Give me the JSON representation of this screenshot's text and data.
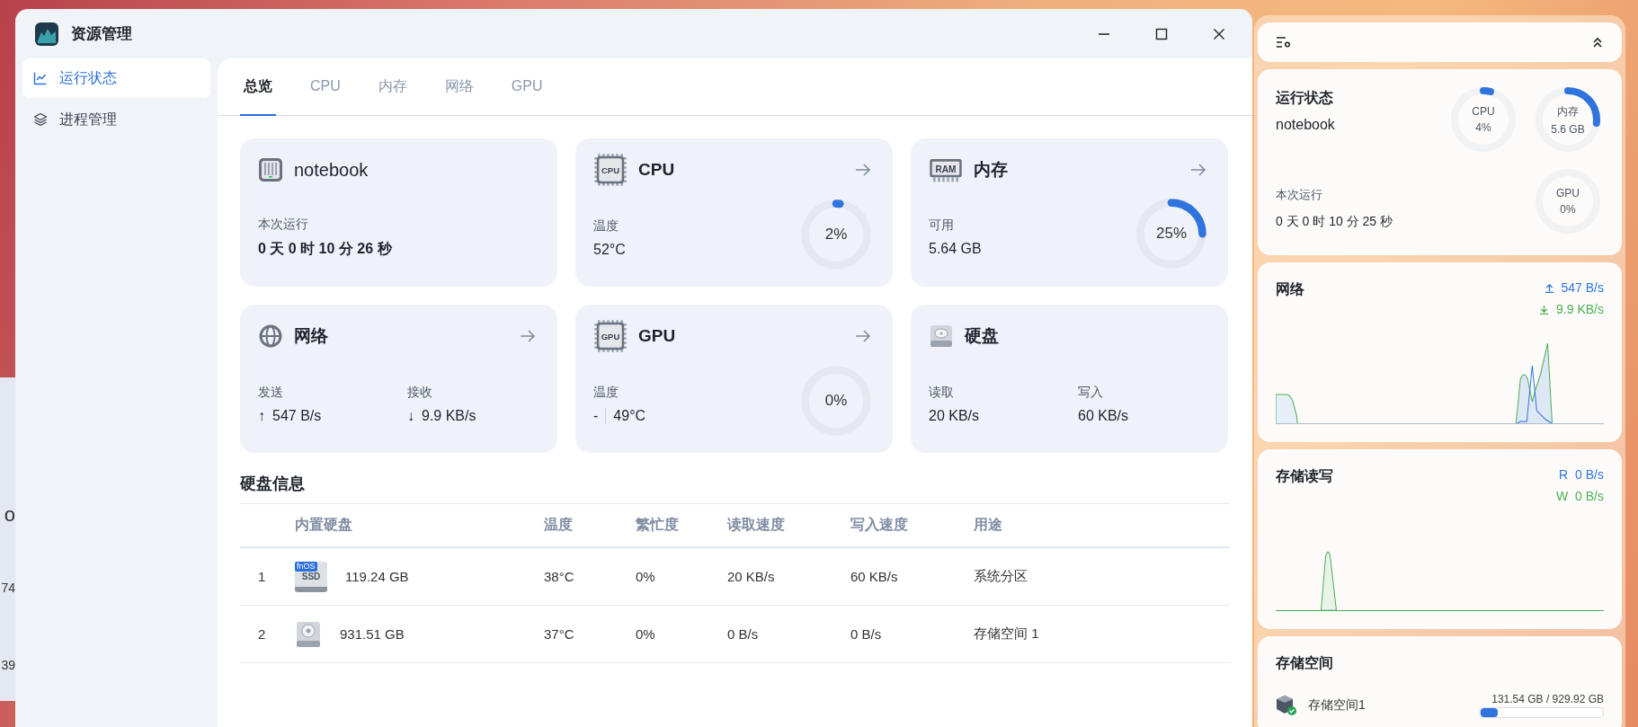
{
  "background_window": {
    "texts": [
      "o",
      "74",
      "39"
    ]
  },
  "window": {
    "title": "资源管理"
  },
  "sidebar": {
    "items": [
      {
        "label": "运行状态",
        "selected": true,
        "kind": "chart"
      },
      {
        "label": "进程管理",
        "selected": false,
        "kind": "layers"
      }
    ]
  },
  "tabs": [
    {
      "label": "总览",
      "selected": true
    },
    {
      "label": "CPU",
      "selected": false
    },
    {
      "label": "内存",
      "selected": false
    },
    {
      "label": "网络",
      "selected": false
    },
    {
      "label": "GPU",
      "selected": false
    }
  ],
  "cards": [
    {
      "kind": "host",
      "title": "notebook",
      "link": false,
      "stats": [
        {
          "label": "本次运行",
          "value": "0 天 0 时 10 分 26 秒"
        }
      ]
    },
    {
      "kind": "chip",
      "chip_label": "CPU",
      "title": "CPU",
      "link": true,
      "stats": [
        {
          "label": "温度",
          "value": "52°C"
        }
      ],
      "gauge": {
        "reading": "2%",
        "level": 0.02
      }
    },
    {
      "kind": "ram",
      "chip_label": "RAM",
      "title": "内存",
      "link": true,
      "stats": [
        {
          "label": "可用",
          "value": "5.64 GB"
        }
      ],
      "gauge": {
        "reading": "25%",
        "level": 0.25
      }
    },
    {
      "kind": "network",
      "title": "网络",
      "link": true,
      "stats": [
        {
          "label": "发送",
          "arrow": "↑",
          "value": "547 B/s"
        },
        {
          "label": "接收",
          "arrow": "↓",
          "value": "9.9 KB/s"
        }
      ]
    },
    {
      "kind": "chip",
      "chip_label": "GPU",
      "title": "GPU",
      "link": true,
      "stats": [
        {
          "label": "温度",
          "value": "-",
          "value_2": "49°C"
        }
      ],
      "gauge": {
        "reading": "0%"
      }
    },
    {
      "kind": "disk",
      "title": "硬盘",
      "link": false,
      "stats": [
        {
          "label": "读取",
          "value": "20 KB/s"
        },
        {
          "label": "写入",
          "value": "60 KB/s"
        }
      ]
    }
  ],
  "disk_info": {
    "title": "硬盘信息",
    "columns": [
      "内置硬盘",
      "温度",
      "繁忙度",
      "读取速度",
      "写入速度",
      "用途"
    ],
    "rows": [
      {
        "index": "1",
        "kind": "ssd",
        "badge": "fnOS",
        "label": "SSD",
        "size": "119.24 GB",
        "temp": "38°C",
        "busy": "0%",
        "read": "20 KB/s",
        "write": "60 KB/s",
        "use": "系统分区"
      },
      {
        "index": "2",
        "kind": "hdd",
        "size": "931.51 GB",
        "temp": "37°C",
        "busy": "0%",
        "read": "0 B/s",
        "write": "0 B/s",
        "use": "存储空间 1"
      }
    ]
  },
  "widgets": {
    "status": {
      "title": "运行状态",
      "host": "notebook",
      "uptime_label": "本次运行",
      "uptime": "0 天 0 时 10 分 25 秒",
      "gauges": [
        {
          "label": "CPU",
          "reading": "4%",
          "level": 0.04
        },
        {
          "label": "内存",
          "reading": "5.6 GB",
          "level": 0.27
        },
        {
          "label": "GPU",
          "reading": "0%"
        }
      ]
    },
    "network": {
      "title": "网络",
      "upload": "547 B/s",
      "download": "9.9 KB/s"
    },
    "storage_io": {
      "title": "存储读写",
      "read_label": "R",
      "read": "0 B/s",
      "write_label": "W",
      "write": "0 B/s"
    },
    "storage_space": {
      "title": "存储空间",
      "volume": "存储空间1",
      "used": "131.54 GB",
      "total": "/ 929.92 GB",
      "level": 0.14
    }
  }
}
